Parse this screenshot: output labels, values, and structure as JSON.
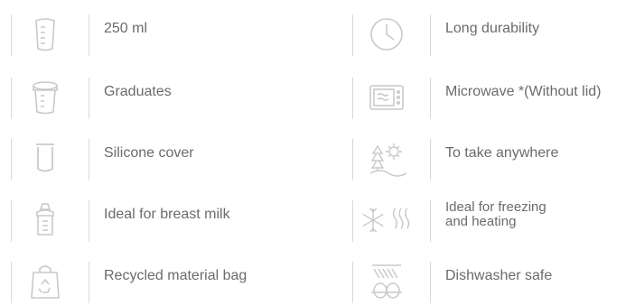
{
  "features_left": [
    {
      "label": "250 ml",
      "icon": "container-icon"
    },
    {
      "label": "Graduates",
      "icon": "graduated-cup-icon"
    },
    {
      "label": "Silicone cover",
      "icon": "silicone-cover-icon"
    },
    {
      "label": "Ideal for breast milk",
      "icon": "baby-bottle-icon"
    },
    {
      "label": "Recycled material bag",
      "icon": "recycle-bag-icon"
    }
  ],
  "features_right": [
    {
      "label": "Long durability",
      "icon": "clock-icon"
    },
    {
      "label": "Microwave *(Without lid)",
      "icon": "microwave-icon"
    },
    {
      "label": "To take anywhere",
      "icon": "outdoor-icon"
    },
    {
      "label_line1": "Ideal for freezing",
      "label_line2": "and heating",
      "icon": "freeze-heat-icon"
    },
    {
      "label": "Dishwasher safe",
      "icon": "dishwasher-icon"
    }
  ],
  "colors": {
    "icon_stroke": "#c9c9c9",
    "text": "#6b6b6b",
    "divider": "#d9d9d9"
  }
}
